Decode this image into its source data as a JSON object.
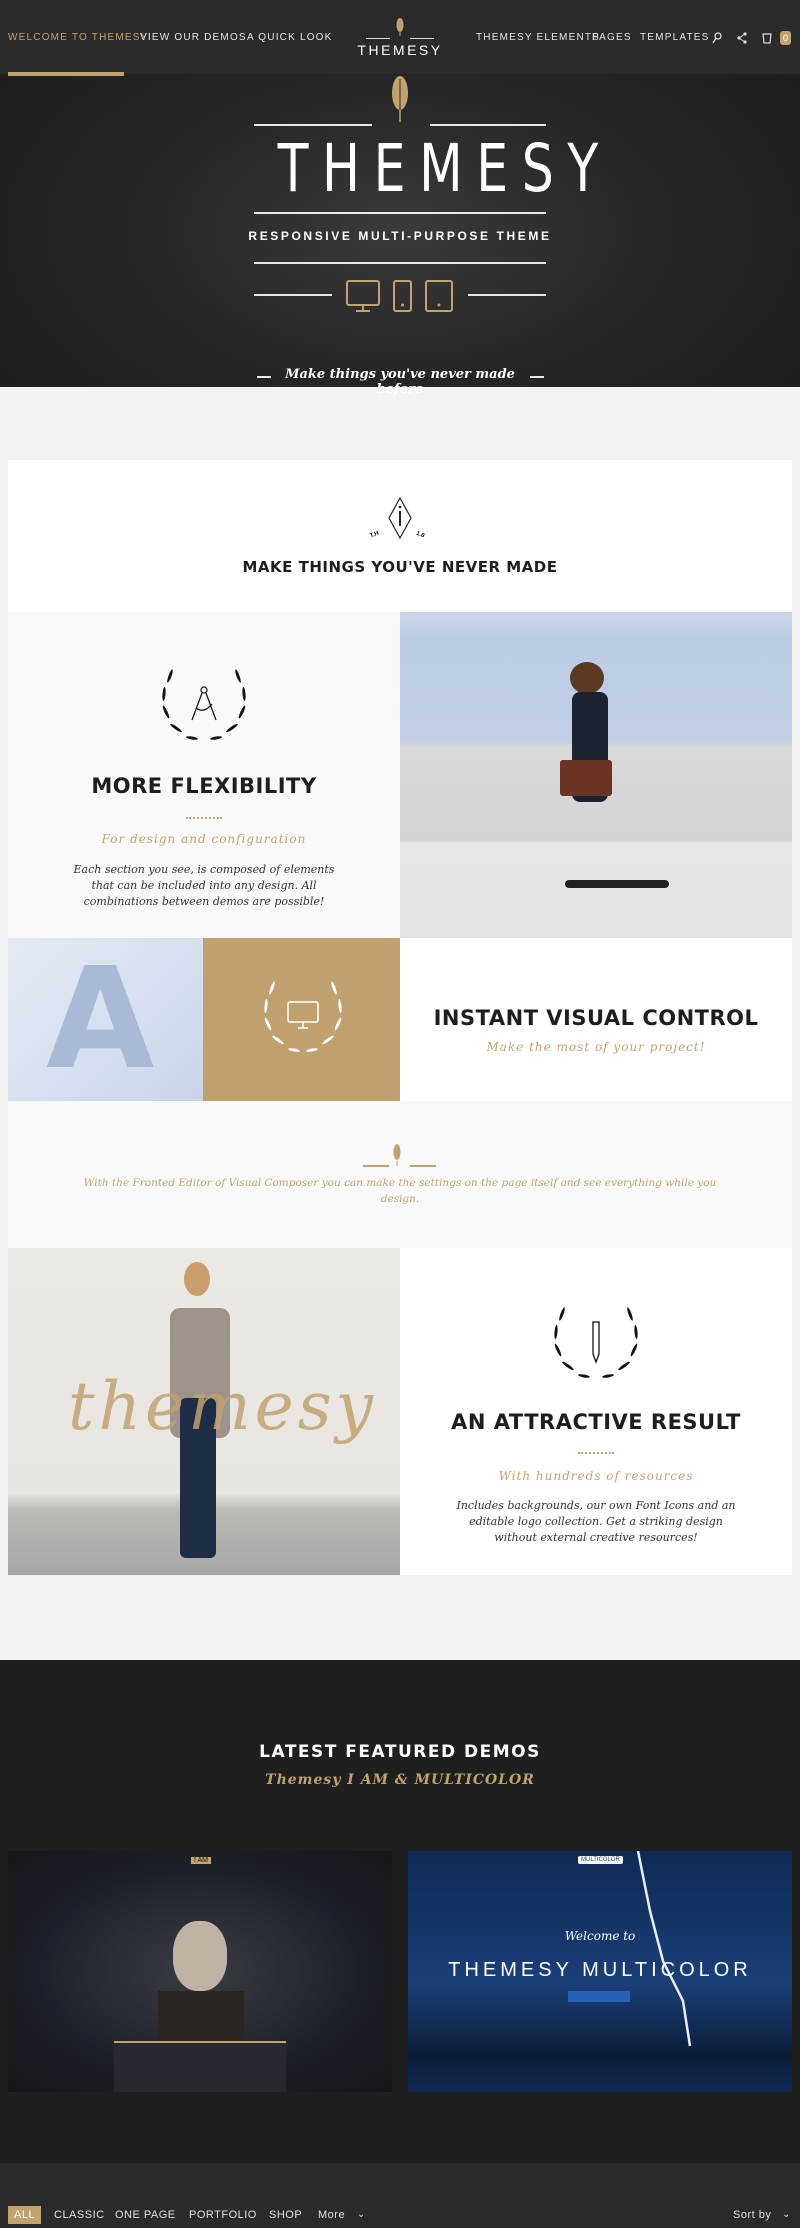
{
  "nav": {
    "left": [
      "WELCOME TO THEMESY",
      "VIEW OUR DEMOS",
      "A QUICK LOOK"
    ],
    "logo": "THEMESY",
    "right": [
      "THEMESY ELEMENTS",
      "PAGES",
      "TEMPLATES"
    ],
    "cart_count": "0"
  },
  "hero": {
    "title": "THEMESY",
    "subtitle": "RESPONSIVE MULTI-PURPOSE THEME",
    "tagline": "Make things you've never made before"
  },
  "intro": {
    "badge_left": "T.H",
    "badge_right": "1.0",
    "heading": "MAKE THINGS YOU'VE NEVER MADE"
  },
  "flexibility": {
    "title": "MORE FLEXIBILITY",
    "subtitle": "For design and configuration",
    "text": "Each section you see, is composed of elements that can be included into any design. All combinations between demos are possible!"
  },
  "visual": {
    "title": "INSTANT VISUAL CONTROL",
    "subtitle": "Make the most of your project!",
    "quote": "With the Fronted Editor of Visual Composer you can make the settings on the page itself and see everything while you design."
  },
  "result": {
    "image_text": "themesy",
    "title": "AN ATTRACTIVE RESULT",
    "subtitle": "With hundreds of resources",
    "text": "Includes backgrounds, our own Font Icons and an editable logo collection. Get a striking design without external creative resources!"
  },
  "demos": {
    "title": "LATEST FEATURED DEMOS",
    "subtitle": "Themesy I AM & MULTICOLOR",
    "demo1_logo": "I AM",
    "demo2_welcome": "Welcome to",
    "demo2_title": "THEMESY MULTICOLOR",
    "demo2_logo": "MULTICOLOR"
  },
  "filters": {
    "items": [
      "ALL",
      "CLASSIC",
      "ONE PAGE",
      "PORTFOLIO",
      "SHOP",
      "More"
    ],
    "sort": "Sort by"
  },
  "colors": {
    "accent": "#c2a36e",
    "dark": "#1e1e1e",
    "nav": "#2b2b2b"
  }
}
